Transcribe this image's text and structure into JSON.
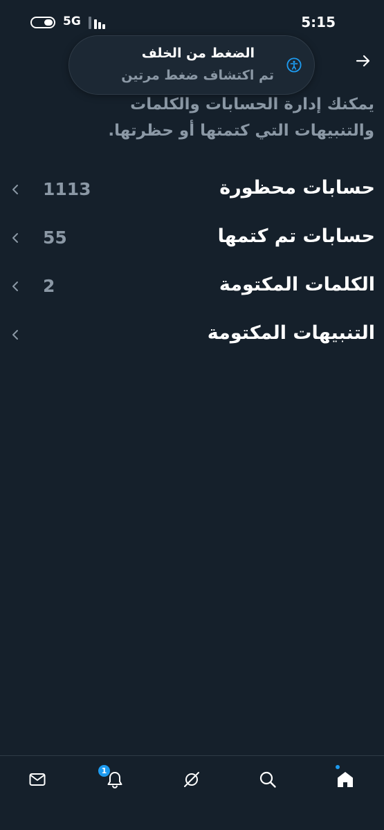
{
  "status_bar": {
    "network": "5G",
    "time": "5:15"
  },
  "toast": {
    "title": "الضغط من الخلف",
    "subtitle": "تم اكتشاف ضغط مرتين",
    "icon": "accessibility-icon"
  },
  "header": {
    "back_icon": "arrow-right-icon"
  },
  "description": "يمكنك إدارة الحسابات والكلمات والتنبيهات التي كتمتها أو حظرتها.",
  "list": {
    "items": [
      {
        "label": "حسابات محظورة",
        "count": "1113"
      },
      {
        "label": "حسابات تم كتمها",
        "count": "55"
      },
      {
        "label": "الكلمات المكتومة",
        "count": "2"
      },
      {
        "label": "التنبيهات المكتومة",
        "count": ""
      }
    ]
  },
  "bottom_nav": {
    "items": [
      "mail-icon",
      "notifications-icon",
      "spaces-icon",
      "search-icon",
      "home-icon"
    ],
    "notification_badge": "1",
    "accent_color": "#1d9bf0"
  }
}
